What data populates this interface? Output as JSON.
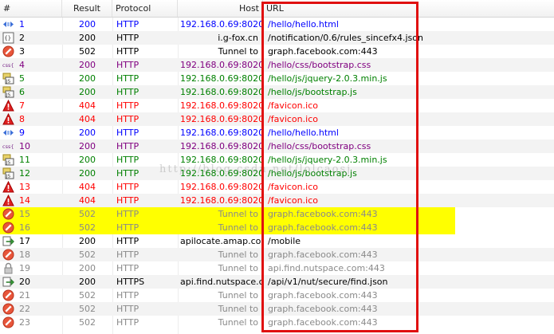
{
  "header": {
    "num": "#",
    "result": "Result",
    "protocol": "Protocol",
    "host": "Host",
    "url": "URL"
  },
  "colors": {
    "blue": "#0000ff",
    "black": "#000000",
    "gray": "#8a8a8a",
    "purple": "#800080",
    "green": "#008000",
    "red": "#ff0000",
    "highlight": "#ffff00",
    "frame": "#e01010"
  },
  "watermark": "http://blog.csdn.net/lolcaosj",
  "sessions": [
    {
      "num": "1",
      "icon": "html-icon",
      "result": "200",
      "protocol": "HTTP",
      "host": "192.168.0.69:8020",
      "url": "/hello/hello.html",
      "color": "blue"
    },
    {
      "num": "2",
      "icon": "json-icon",
      "result": "200",
      "protocol": "HTTP",
      "host": "i.g-fox.cn",
      "url": "/notification/0.6/rules_sincefx4.json",
      "color": "black"
    },
    {
      "num": "3",
      "icon": "blocked-icon",
      "result": "502",
      "protocol": "HTTP",
      "host": "Tunnel to",
      "url": "graph.facebook.com:443",
      "color": "black"
    },
    {
      "num": "4",
      "icon": "css-icon",
      "result": "200",
      "protocol": "HTTP",
      "host": "192.168.0.69:8020",
      "url": "/hello/css/bootstrap.css",
      "color": "purple"
    },
    {
      "num": "5",
      "icon": "js-icon",
      "result": "200",
      "protocol": "HTTP",
      "host": "192.168.0.69:8020",
      "url": "/hello/js/jquery-2.0.3.min.js",
      "color": "green"
    },
    {
      "num": "6",
      "icon": "js-icon",
      "result": "200",
      "protocol": "HTTP",
      "host": "192.168.0.69:8020",
      "url": "/hello/js/bootstrap.js",
      "color": "green"
    },
    {
      "num": "7",
      "icon": "warning-icon",
      "result": "404",
      "protocol": "HTTP",
      "host": "192.168.0.69:8020",
      "url": "/favicon.ico",
      "color": "red"
    },
    {
      "num": "8",
      "icon": "warning-icon",
      "result": "404",
      "protocol": "HTTP",
      "host": "192.168.0.69:8020",
      "url": "/favicon.ico",
      "color": "red"
    },
    {
      "num": "9",
      "icon": "html-icon",
      "result": "200",
      "protocol": "HTTP",
      "host": "192.168.0.69:8020",
      "url": "/hello/hello.html",
      "color": "blue"
    },
    {
      "num": "10",
      "icon": "css-icon",
      "result": "200",
      "protocol": "HTTP",
      "host": "192.168.0.69:8020",
      "url": "/hello/css/bootstrap.css",
      "color": "purple"
    },
    {
      "num": "11",
      "icon": "js-icon",
      "result": "200",
      "protocol": "HTTP",
      "host": "192.168.0.69:8020",
      "url": "/hello/js/jquery-2.0.3.min.js",
      "color": "green"
    },
    {
      "num": "12",
      "icon": "js-icon",
      "result": "200",
      "protocol": "HTTP",
      "host": "192.168.0.69:8020",
      "url": "/hello/js/bootstrap.js",
      "color": "green"
    },
    {
      "num": "13",
      "icon": "warning-icon",
      "result": "404",
      "protocol": "HTTP",
      "host": "192.168.0.69:8020",
      "url": "/favicon.ico",
      "color": "red"
    },
    {
      "num": "14",
      "icon": "warning-icon",
      "result": "404",
      "protocol": "HTTP",
      "host": "192.168.0.69:8020",
      "url": "/favicon.ico",
      "color": "red"
    },
    {
      "num": "15",
      "icon": "blocked-icon",
      "result": "502",
      "protocol": "HTTP",
      "host": "Tunnel to",
      "url": "graph.facebook.com:443",
      "color": "gray",
      "highlight": true
    },
    {
      "num": "16",
      "icon": "blocked-icon",
      "result": "502",
      "protocol": "HTTP",
      "host": "Tunnel to",
      "url": "graph.facebook.com:443",
      "color": "gray",
      "highlight": true
    },
    {
      "num": "17",
      "icon": "arrow-icon",
      "result": "200",
      "protocol": "HTTP",
      "host": "apilocate.amap.com",
      "url": "/mobile",
      "color": "black"
    },
    {
      "num": "18",
      "icon": "blocked-icon",
      "result": "502",
      "protocol": "HTTP",
      "host": "Tunnel to",
      "url": "graph.facebook.com:443",
      "color": "gray"
    },
    {
      "num": "19",
      "icon": "lock-icon",
      "result": "200",
      "protocol": "HTTP",
      "host": "Tunnel to",
      "url": "api.find.nutspace.com:443",
      "color": "gray"
    },
    {
      "num": "20",
      "icon": "arrow-icon",
      "result": "200",
      "protocol": "HTTPS",
      "host": "api.find.nutspace.com",
      "url": "/api/v1/nut/secure/find.json",
      "color": "black"
    },
    {
      "num": "21",
      "icon": "blocked-icon",
      "result": "502",
      "protocol": "HTTP",
      "host": "Tunnel to",
      "url": "graph.facebook.com:443",
      "color": "gray"
    },
    {
      "num": "22",
      "icon": "blocked-icon",
      "result": "502",
      "protocol": "HTTP",
      "host": "Tunnel to",
      "url": "graph.facebook.com:443",
      "color": "gray"
    },
    {
      "num": "23",
      "icon": "blocked-icon",
      "result": "502",
      "protocol": "HTTP",
      "host": "Tunnel to",
      "url": "graph.facebook.com:443",
      "color": "gray"
    }
  ]
}
